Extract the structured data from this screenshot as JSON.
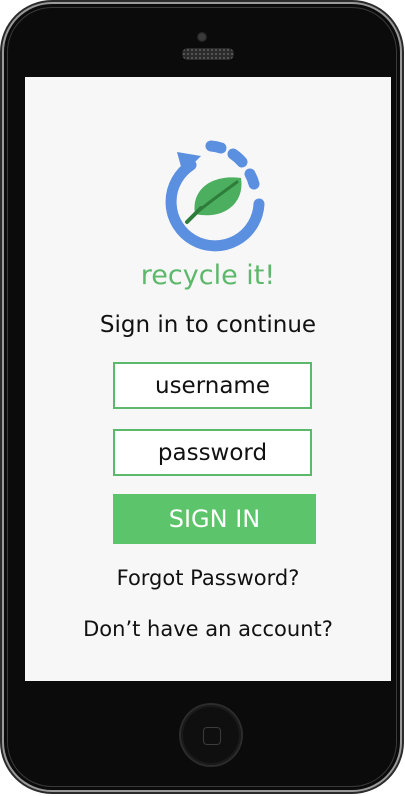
{
  "app": {
    "name": "recycle it!",
    "subtitle": "Sign in to continue"
  },
  "form": {
    "username_placeholder": "username",
    "password_placeholder": "password",
    "signin_label": "SIGN IN"
  },
  "links": {
    "forgot": "Forgot Password?",
    "no_account": "Don’t have an account?"
  },
  "icons": {
    "logo": "recycle-leaf-icon",
    "home": "home-button-icon",
    "camera": "camera-icon",
    "speaker": "speaker-icon"
  },
  "colors": {
    "brand_green": "#5cb86a",
    "button_green": "#5cc46a",
    "logo_blue": "#5b8fe0",
    "leaf_green": "#4caf60",
    "screen_bg": "#f7f7f7",
    "device": "#0b0b0b"
  }
}
